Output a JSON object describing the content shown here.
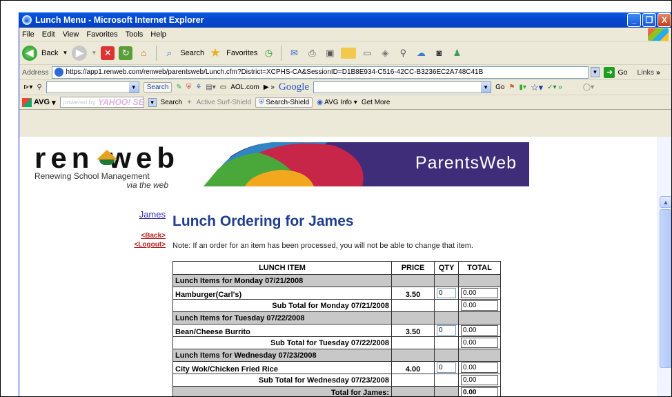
{
  "window": {
    "title": "Lunch Menu - Microsoft Internet Explorer",
    "controls": [
      "_",
      "❐",
      "X"
    ]
  },
  "menu": [
    "File",
    "Edit",
    "View",
    "Favorites",
    "Tools",
    "Help"
  ],
  "toolbar": {
    "back_label": "Back",
    "search_label": "Search",
    "favorites_label": "Favorites"
  },
  "address": {
    "label": "Address",
    "url": "https://app1.renweb.com/renweb/parentsweb/Lunch.cfm?District=XCPHS-CA&SessionID=D1B8E934-C516-42CC-B3236EC2A748C41B",
    "go_label": "Go",
    "links_label": "Links"
  },
  "bar3": {
    "search_btn": "Search",
    "aol_label": "AOL.com",
    "google_label": "Google",
    "go_label": "Go"
  },
  "avg_bar": {
    "avg_label": "AVG",
    "yahoo_placeholder": "powered by",
    "yahoo_brand": "YAHOO! SEARCH",
    "search_label": "Search",
    "active_surf": "Active Surf-Shield",
    "search_shield": "Search-Shield",
    "avg_info": "AVG Info",
    "get_more": "Get More"
  },
  "logo": {
    "word_left": "ren",
    "word_right": "web",
    "tagline": "Renewing School Management",
    "via": "via the web"
  },
  "banner": {
    "text": "ParentsWeb"
  },
  "nav": {
    "student": "James",
    "back": "<Back>",
    "logout": "<Logout>"
  },
  "page": {
    "heading": "Lunch Ordering for James",
    "note": "Note: If an order for an item has been processed, you will not be able to change that item."
  },
  "table": {
    "headers": [
      "LUNCH ITEM",
      "PRICE",
      "QTY",
      "TOTAL"
    ],
    "days": [
      {
        "group_label": "Lunch Items for Monday 07/21/2008",
        "item": "Hamburger(Carl's)",
        "price": "3.50",
        "qty": "0",
        "total": "0.00",
        "subtotal_label": "Sub Total for Monday 07/21/2008",
        "subtotal": "0.00"
      },
      {
        "group_label": "Lunch Items for Tuesday 07/22/2008",
        "item": "Bean/Cheese Burrito",
        "price": "3.50",
        "qty": "0",
        "total": "0.00",
        "subtotal_label": "Sub Total for Tuesday 07/22/2008",
        "subtotal": "0.00"
      },
      {
        "group_label": "Lunch Items for Wednesday 07/23/2008",
        "item": "City Wok/Chicken Fried Rice",
        "price": "4.00",
        "qty": "0",
        "total": "0.00",
        "subtotal_label": "Sub Total for Wednesday 07/23/2008",
        "subtotal": "0.00"
      }
    ],
    "grand_total_label": "Total for James:",
    "grand_total": "0.00"
  }
}
